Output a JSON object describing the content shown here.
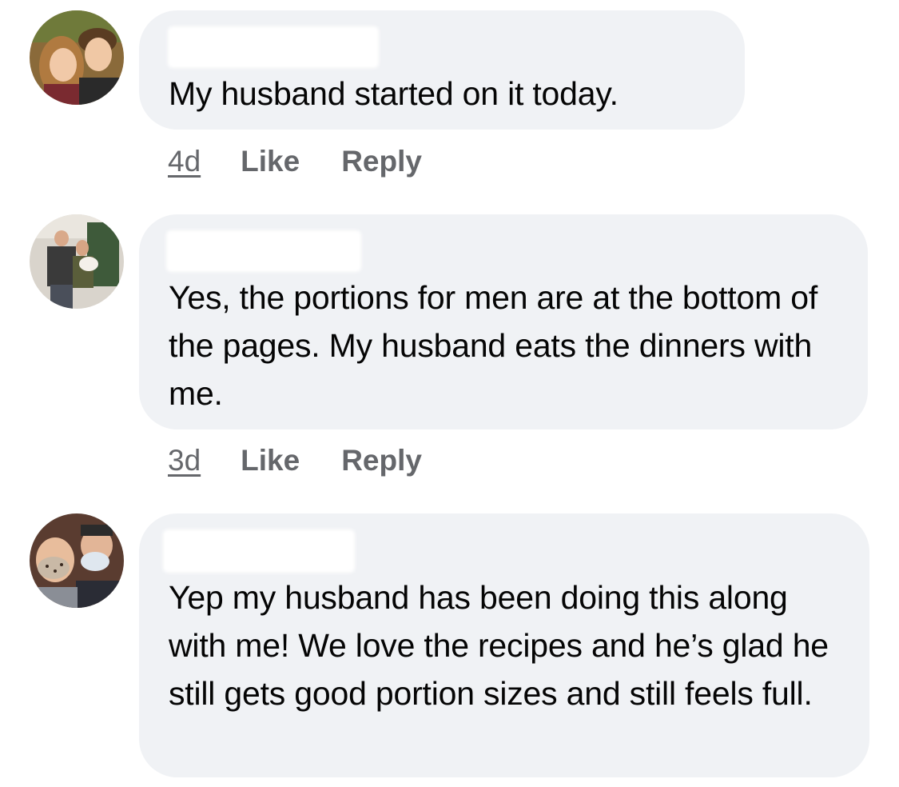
{
  "colors": {
    "bubble_bg": "#f0f2f5",
    "text_primary": "#050505",
    "text_secondary": "#65676b"
  },
  "comments": [
    {
      "avatar_icon": "profile-photo-two-kids",
      "text": "My husband started on it today.",
      "time": "4d",
      "like_label": "Like",
      "reply_label": "Reply"
    },
    {
      "avatar_icon": "profile-photo-couple-with-dog",
      "text": "Yes, the portions for men are at the bottom of the pages. My husband eats the dinners with me.",
      "time": "3d",
      "like_label": "Like",
      "reply_label": "Reply"
    },
    {
      "avatar_icon": "profile-photo-couple-masks",
      "text": "Yep my husband has been doing this along with me! We love the recipes and he’s glad he still gets good portion sizes and still feels full."
    }
  ]
}
